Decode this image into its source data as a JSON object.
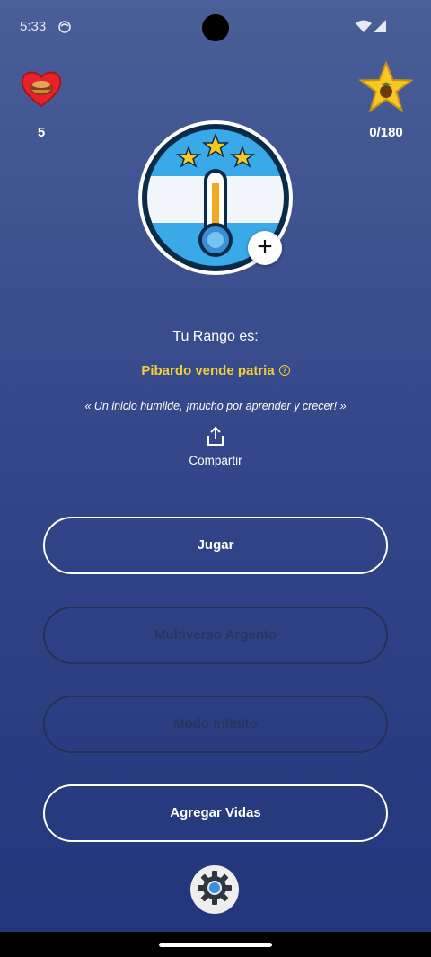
{
  "status_bar": {
    "time": "5:33",
    "icons": [
      "sync-icon",
      "wifi-icon",
      "signal-icon"
    ]
  },
  "lives": {
    "icon": "heart-icon",
    "count": "5"
  },
  "stars": {
    "icon": "star-icon",
    "count": "0/180"
  },
  "emblem": {
    "icon": "thermometer-icon",
    "add_icon": "plus-icon",
    "add_label": "+"
  },
  "rank": {
    "label": "Tu Rango es:",
    "name": "Pibardo vende patria",
    "help_icon": "?",
    "quote": "« Un inicio humilde, ¡mucho por aprender y crecer! »"
  },
  "share": {
    "icon": "share-icon",
    "label": "Compartir"
  },
  "buttons": {
    "play": "Jugar",
    "multiverse": "Multiverso Argento",
    "infinite": "Modo Infinito",
    "add_lives": "Agregar Vidas"
  },
  "settings": {
    "icon": "gear-icon"
  },
  "colors": {
    "accent_yellow": "#f2cd3a",
    "background_top": "#4a5f97",
    "background_bottom": "#22357a",
    "disabled_text": "#26365f"
  }
}
